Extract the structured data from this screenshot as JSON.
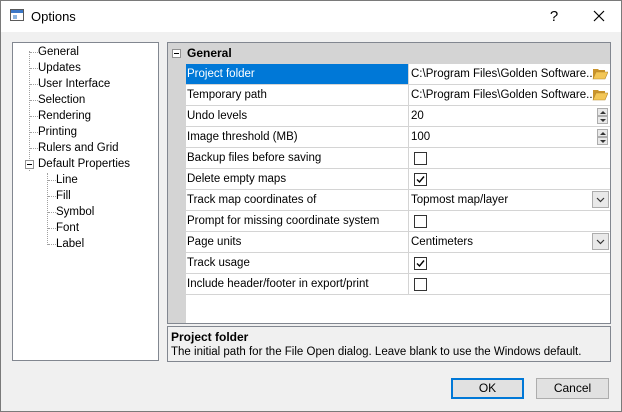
{
  "window": {
    "title": "Options"
  },
  "titlebar": {
    "help_label": "?",
    "close_icon": "close-icon"
  },
  "tree": {
    "items": [
      {
        "label": "General"
      },
      {
        "label": "Updates"
      },
      {
        "label": "User Interface"
      },
      {
        "label": "Selection"
      },
      {
        "label": "Rendering"
      },
      {
        "label": "Printing"
      },
      {
        "label": "Rulers and Grid"
      },
      {
        "label": "Default Properties",
        "expanded": true
      },
      {
        "label": "Line"
      },
      {
        "label": "Fill"
      },
      {
        "label": "Symbol"
      },
      {
        "label": "Font"
      },
      {
        "label": "Label"
      }
    ]
  },
  "grid": {
    "category": "General",
    "rows": [
      {
        "name": "Project folder",
        "value": "C:\\Program Files\\Golden Software...",
        "editor": "folder",
        "selected": true
      },
      {
        "name": "Temporary path",
        "value": "C:\\Program Files\\Golden Software...",
        "editor": "folder"
      },
      {
        "name": "Undo levels",
        "value": "20",
        "editor": "spin"
      },
      {
        "name": "Image threshold (MB)",
        "value": "100",
        "editor": "spin"
      },
      {
        "name": "Backup files before saving",
        "checked": false,
        "editor": "checkbox"
      },
      {
        "name": "Delete empty maps",
        "checked": true,
        "editor": "checkbox"
      },
      {
        "name": "Track map coordinates of",
        "value": "Topmost map/layer",
        "editor": "dropdown"
      },
      {
        "name": "Prompt for missing coordinate system",
        "checked": false,
        "editor": "checkbox"
      },
      {
        "name": "Page units",
        "value": "Centimeters",
        "editor": "dropdown"
      },
      {
        "name": "Track usage",
        "checked": true,
        "editor": "checkbox"
      },
      {
        "name": "Include header/footer in export/print",
        "checked": false,
        "editor": "checkbox"
      }
    ]
  },
  "description": {
    "title": "Project folder",
    "text": "The initial path for the File Open dialog.  Leave blank to use the Windows default."
  },
  "buttons": {
    "ok": "OK",
    "cancel": "Cancel"
  },
  "colors": {
    "selection": "#0078d7",
    "category_bg": "#d4d4d4",
    "folder_yellow": "#e8b84a"
  }
}
